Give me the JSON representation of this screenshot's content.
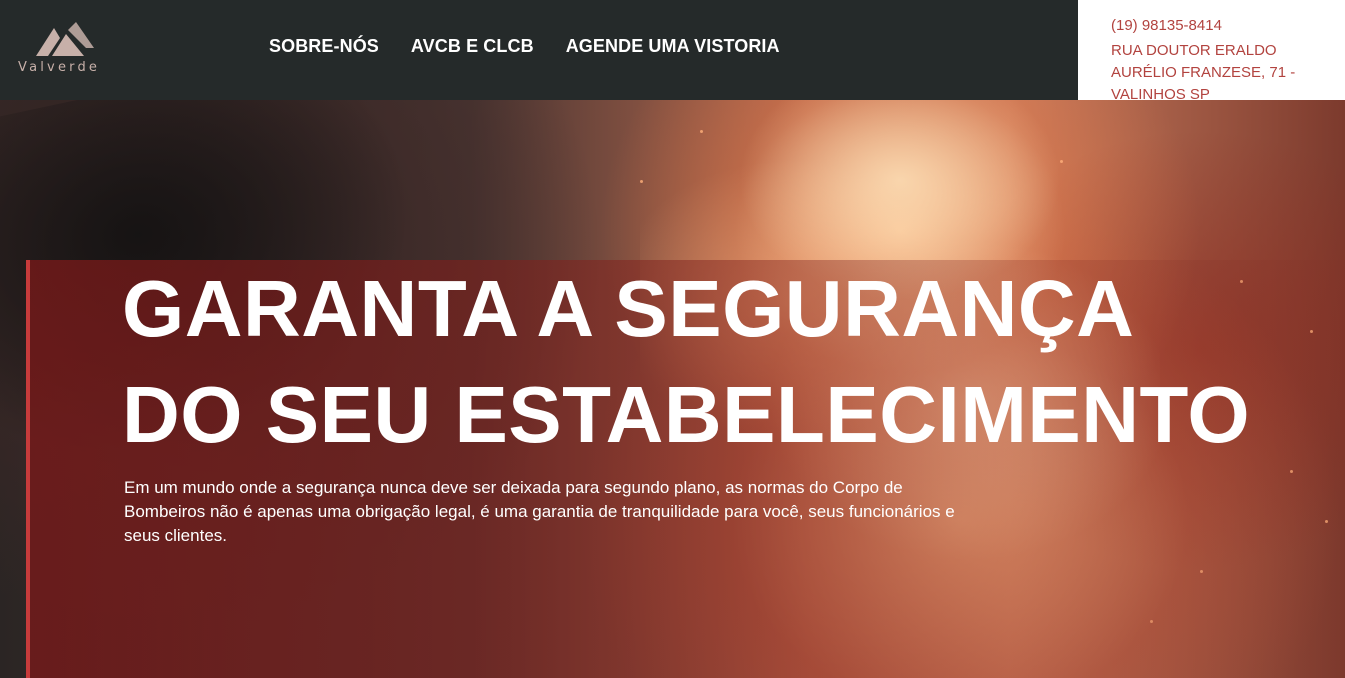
{
  "brand": {
    "name": "Valverde",
    "logo_color": "#c7b0a9"
  },
  "nav": {
    "items": [
      {
        "label": "SOBRE-NÓS"
      },
      {
        "label": "AVCB E CLCB"
      },
      {
        "label": "AGENDE UMA VISTORIA"
      }
    ]
  },
  "contact": {
    "phone": "(19) 98135-8414",
    "address": "RUA DOUTOR ERALDO AURÉLIO FRANZESE, 71 - VALINHOS SP",
    "text_color": "#b2433f"
  },
  "hero": {
    "headline_line1": "GARANTA A SEGURANÇA",
    "headline_line2": "DO SEU ESTABELECIMENTO",
    "lead": "Em um mundo onde a segurança nunca deve ser deixada para segundo plano, as normas do Corpo de Bombeiros não é apenas uma obrigação legal, é uma garantia de tranquilidade para você, seus funcionários e seus clientes.",
    "accent_color": "#c73b3b"
  },
  "colors": {
    "header_bg": "#252a2a",
    "contact_bg": "#ffffff",
    "text_light": "#ffffff"
  }
}
